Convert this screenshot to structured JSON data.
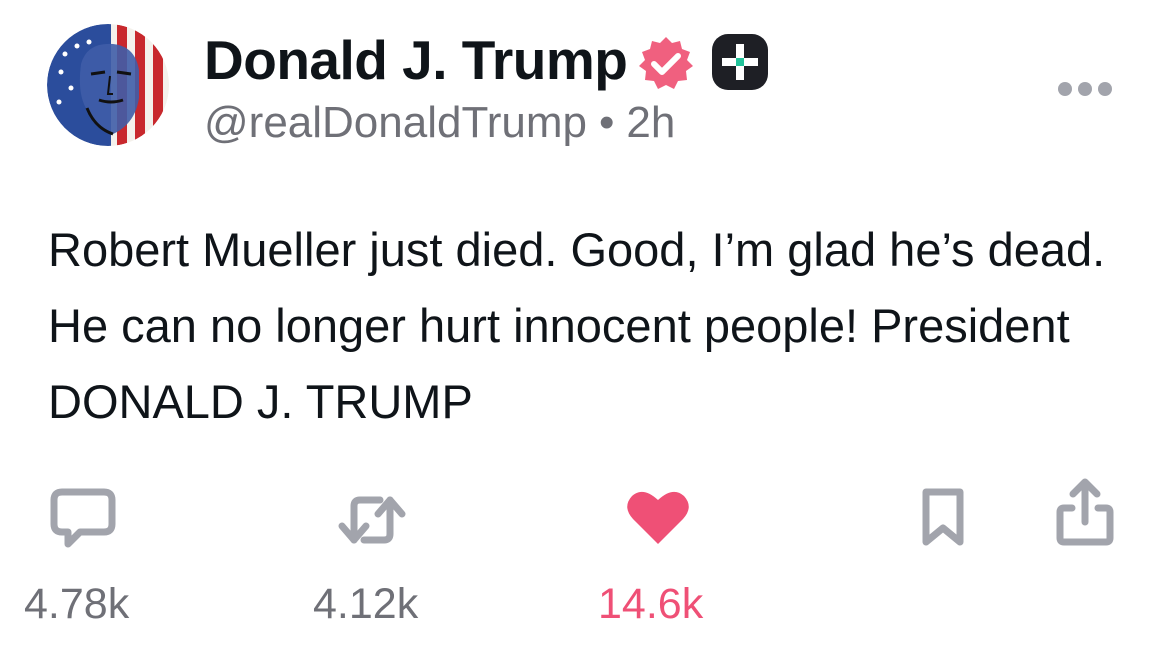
{
  "post": {
    "author": {
      "display_name": "Donald J. Trump",
      "handle": "@realDonaldTrump",
      "separator": "•",
      "time_ago": "2h"
    },
    "text": "Robert Mueller just died. Good, I’m glad he’s dead. He can no longer hurt innocent people! President DONALD J. TRUMP",
    "actions": {
      "reply_count": "4.78k",
      "repost_count": "4.12k",
      "like_count": "14.6k",
      "liked": true
    }
  },
  "icons": {
    "verified": "verified-badge-icon",
    "plus": "plus-badge-icon",
    "more": "more-horizontal-icon",
    "reply": "comment-bubble-icon",
    "repost": "repost-arrows-icon",
    "like": "heart-icon",
    "bookmark": "bookmark-icon",
    "share": "share-icon"
  },
  "colors": {
    "text": "#0f1419",
    "muted": "#6f7077",
    "icon_gray": "#a2a4ac",
    "like_pink": "#ef5076",
    "verified_pink": "#f0607f",
    "plus_dark": "#1e1f25",
    "plus_accent": "#22c39a"
  }
}
